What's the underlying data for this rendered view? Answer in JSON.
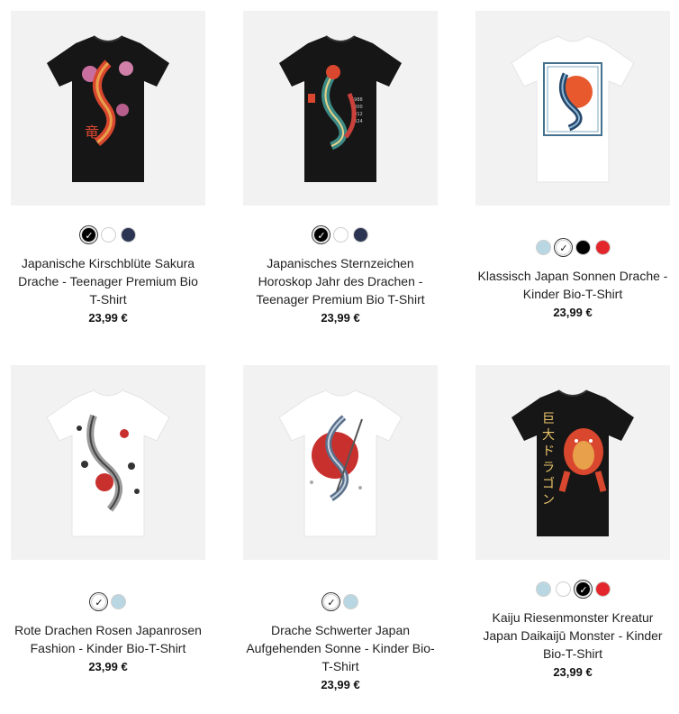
{
  "products": [
    {
      "image_alt": "Japanische Kirschblüte Sakura Drache T-Shirt",
      "shirt_color": "#161616",
      "title_lines": [
        "Japanische Kirschblüte Sakura",
        "Drache - Teenager Premium Bio",
        "T-Shirt"
      ],
      "price": "23,99 €",
      "swatches": [
        {
          "color": "#000000",
          "selected": true
        },
        {
          "color": "#ffffff",
          "selected": false
        },
        {
          "color": "#2b3452",
          "selected": false
        }
      ]
    },
    {
      "image_alt": "Japanisches Sternzeichen Horoskop Jahr des Drachen T-Shirt",
      "shirt_color": "#161616",
      "title_lines": [
        "Japanisches Sternzeichen",
        "Horoskop Jahr des Drachen -",
        "Teenager Premium Bio T-Shirt"
      ],
      "price": "23,99 €",
      "swatches": [
        {
          "color": "#000000",
          "selected": true
        },
        {
          "color": "#ffffff",
          "selected": false
        },
        {
          "color": "#2b3452",
          "selected": false
        }
      ]
    },
    {
      "image_alt": "Klassisch Japan Sonnen Drache T-Shirt",
      "shirt_color": "#ffffff",
      "title_lines": [
        "Klassisch Japan Sonnen Drache -",
        "Kinder Bio-T-Shirt"
      ],
      "price": "23,99 €",
      "swatches": [
        {
          "color": "#b9d7e3",
          "selected": false
        },
        {
          "color": "#ffffff",
          "selected": true
        },
        {
          "color": "#000000",
          "selected": false
        },
        {
          "color": "#e3262b",
          "selected": false
        }
      ]
    },
    {
      "image_alt": "Rote Drachen Rosen Japanrosen Fashion T-Shirt",
      "shirt_color": "#ffffff",
      "title_lines": [
        "Rote Drachen Rosen Japanrosen",
        "Fashion - Kinder Bio-T-Shirt"
      ],
      "price": "23,99 €",
      "swatches": [
        {
          "color": "#ffffff",
          "selected": true
        },
        {
          "color": "#b9d7e3",
          "selected": false
        }
      ]
    },
    {
      "image_alt": "Drache Schwerter Japan Aufgehenden Sonne T-Shirt",
      "shirt_color": "#ffffff",
      "title_lines": [
        "Drache Schwerter Japan",
        "Aufgehenden Sonne - Kinder Bio-",
        "T-Shirt"
      ],
      "price": "23,99 €",
      "swatches": [
        {
          "color": "#ffffff",
          "selected": true
        },
        {
          "color": "#b9d7e3",
          "selected": false
        }
      ]
    },
    {
      "image_alt": "Kaiju Riesenmonster Kreatur Japan Daikaijū Monster T-Shirt",
      "shirt_color": "#161616",
      "title_lines": [
        "Kaiju Riesenmonster Kreatur",
        "Japan Daikaijū Monster - Kinder",
        "Bio-T-Shirt"
      ],
      "price": "23,99 €",
      "swatches": [
        {
          "color": "#b9d7e3",
          "selected": false
        },
        {
          "color": "#ffffff",
          "selected": false
        },
        {
          "color": "#000000",
          "selected": true
        },
        {
          "color": "#e3262b",
          "selected": false
        }
      ]
    }
  ]
}
